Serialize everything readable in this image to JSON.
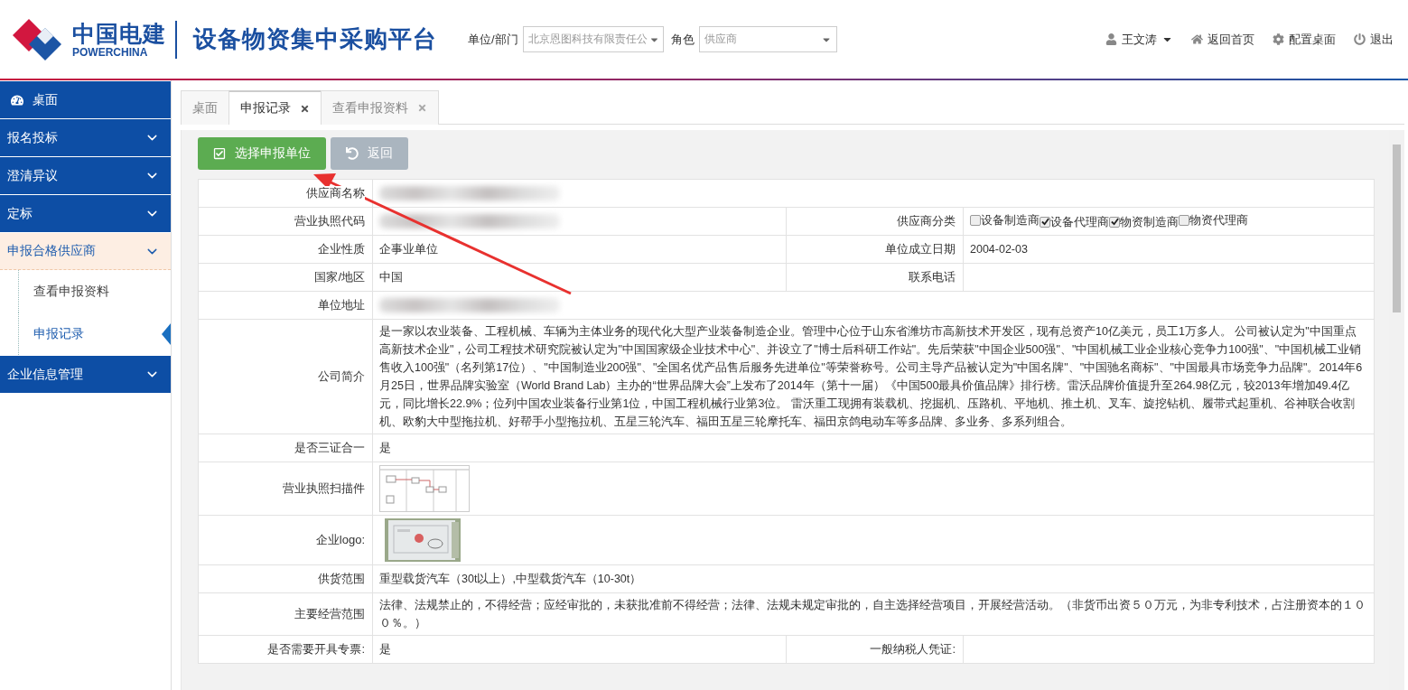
{
  "header": {
    "brand_cn": "中国电建",
    "brand_en": "POWERCHINA",
    "platform": "设备物资集中采购平台",
    "unit_label": "单位/部门",
    "unit_value": "北京恩图科技有限责任公",
    "role_label": "角色",
    "role_value": "供应商",
    "user": "王文涛",
    "links": [
      {
        "kind": "home",
        "label": "返回首页"
      },
      {
        "kind": "settings",
        "label": "配置桌面"
      },
      {
        "kind": "logout",
        "label": "退出"
      }
    ]
  },
  "sidebar": {
    "items": [
      {
        "kind": "link",
        "label": "桌面"
      },
      {
        "kind": "group",
        "label": "报名投标",
        "expanded": false
      },
      {
        "kind": "group",
        "label": "澄清异议",
        "expanded": false
      },
      {
        "kind": "group",
        "label": "定标",
        "expanded": false
      },
      {
        "kind": "group",
        "label": "申报合格供应商",
        "expanded": true,
        "children": [
          {
            "label": "查看申报资料",
            "selected": false
          },
          {
            "label": "申报记录",
            "selected": true
          }
        ]
      },
      {
        "kind": "group",
        "label": "企业信息管理",
        "expanded": false
      }
    ]
  },
  "tabs": [
    {
      "label": "桌面",
      "closable": false,
      "selected": false
    },
    {
      "label": "申报记录",
      "closable": true,
      "selected": true
    },
    {
      "label": "查看申报资料",
      "closable": true,
      "selected": false
    }
  ],
  "toolbar": {
    "buttons": [
      {
        "kind": "primary",
        "label": "选择申报单位"
      },
      {
        "kind": "back",
        "label": "返回"
      }
    ]
  },
  "rows": [
    {
      "label": "供应商名称",
      "kind": "blurred"
    },
    {
      "label": "营业执照代码",
      "kind": "blurred",
      "label2": "供应商分类",
      "options": [
        {
          "label": "设备制造商",
          "checked": false
        },
        {
          "label": "设备代理商",
          "checked": true
        },
        {
          "label": "物资制造商",
          "checked": true
        },
        {
          "label": "物资代理商",
          "checked": false
        }
      ]
    },
    {
      "label": "企业性质",
      "kind": "text",
      "value": "企事业单位",
      "label2": "单位成立日期",
      "value2": "2004-02-03"
    },
    {
      "label": "国家/地区",
      "kind": "text",
      "value": "中国",
      "label2": "联系电话"
    },
    {
      "label": "单位地址",
      "kind": "blurred"
    },
    {
      "label": "公司简介",
      "kind": "text",
      "value": "是一家以农业装备、工程机械、车辆为主体业务的现代化大型产业装备制造企业。管理中心位于山东省潍坊市高新技术开发区，现有总资产10亿美元，员工1万多人。 公司被认定为\"中国重点高新技术企业\"，公司工程技术研究院被认定为\"中国国家级企业技术中心\"、并设立了\"博士后科研工作站\"。先后荣获\"中国企业500强\"、\"中国机械工业企业核心竞争力100强\"、\"中国机械工业销售收入100强\"（名列第17位）、\"中国制造业200强\"、\"全国名优产品售后服务先进单位\"等荣誉称号。公司主导产品被认定为\"中国名牌\"、\"中国驰名商标\"、\"中国最具市场竞争力品牌\"。2014年6月25日，世界品牌实验室（World Brand Lab）主办的“世界品牌大会”上发布了2014年（第十一届）《中国500最具价值品牌》排行榜。雷沃品牌价值提升至264.98亿元，较2013年增加49.4亿元，同比增长22.9%；位列中国农业装备行业第1位，中国工程机械行业第3位。 雷沃重工现拥有装载机、挖掘机、压路机、平地机、推土机、叉车、旋挖钻机、履带式起重机、谷神联合收割机、欧豹大中型拖拉机、好帮手小型拖拉机、五星三轮汽车、福田五星三轮摩托车、福田京鸽电动车等多品牌、多业务、多系列组合。"
    },
    {
      "label": "是否三证合一",
      "kind": "text",
      "value": "是"
    },
    {
      "label": "营业执照扫描件",
      "kind": "scan"
    },
    {
      "label": "企业logo:"
    },
    {
      "label": "供货范围",
      "kind": "text",
      "value": "重型载货汽车（30t以上）,中型载货汽车（10-30t）"
    },
    {
      "label": "主要经营范围",
      "kind": "text",
      "value": "法律、法规禁止的，不得经营；应经审批的，未获批准前不得经营；法律、法规未规定审批的，自主选择经营项目，开展经营活动。（非货币出资５０万元，为非专利技术，占注册资本的１００％。）"
    },
    {
      "label": "是否需要开具专票:",
      "kind": "text",
      "value": "是",
      "label2": "一般纳税人凭证:"
    }
  ]
}
